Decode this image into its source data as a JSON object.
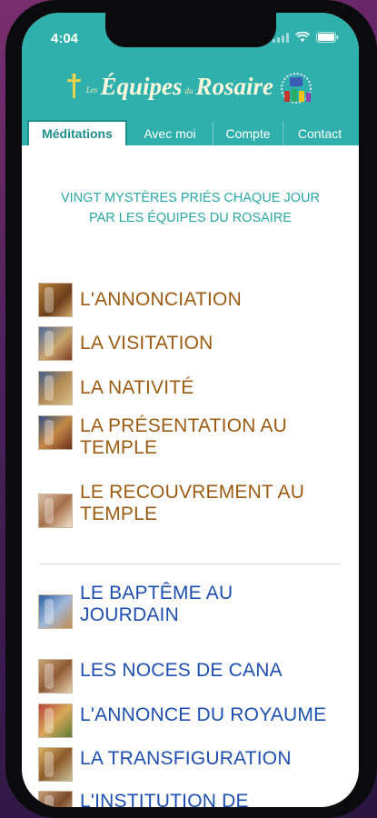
{
  "status": {
    "time": "4:04"
  },
  "header": {
    "logo_les": "Les",
    "logo_equipes": "Équipes",
    "logo_du": "du",
    "logo_rosaire": "Rosaire"
  },
  "tabs": [
    {
      "label": "Méditations",
      "active": true
    },
    {
      "label": "Avec moi",
      "active": false
    },
    {
      "label": "Compte",
      "active": false
    },
    {
      "label": "Contact",
      "active": false
    }
  ],
  "intro": {
    "line1": "VINGT MYSTÈRES PRIÉS CHAQUE JOUR",
    "line2": "PAR LES ÉQUIPES DU ROSAIRE"
  },
  "mysteries_joyful": [
    {
      "label": "L'ANNONCIATION"
    },
    {
      "label": "LA VISITATION"
    },
    {
      "label": "LA NATIVITÉ"
    },
    {
      "label": "LA PRÉSENTATION AU TEMPLE"
    },
    {
      "label": "LE RECOUVREMENT AU TEMPLE"
    }
  ],
  "mysteries_luminous": [
    {
      "label": "LE BAPTÊME AU JOURDAIN"
    },
    {
      "label": "LES NOCES DE CANA"
    },
    {
      "label": "L'ANNONCE DU ROYAUME"
    },
    {
      "label": "LA TRANSFIGURATION"
    },
    {
      "label": "L'INSTITUTION DE L'EUCHARISTIE"
    }
  ],
  "colors": {
    "header": "#2fb0ac",
    "joyful": "#9b5b12",
    "luminous": "#1f4fae",
    "intro": "#2aa7a3"
  }
}
